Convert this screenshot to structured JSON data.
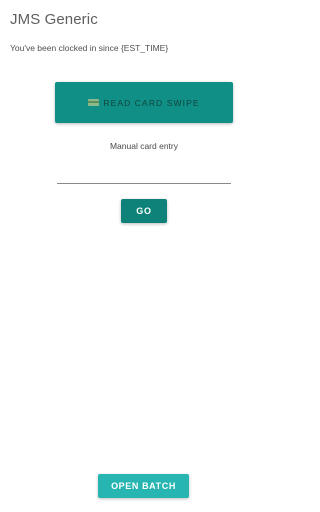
{
  "app": {
    "title": "JMS Generic"
  },
  "status": {
    "clock_message": "You've been clocked in since {EST_TIME}"
  },
  "card_swipe": {
    "button_label": "READ CARD SWIPE",
    "icon": "credit-card-icon",
    "accent_color": "#0f8f85"
  },
  "manual_entry": {
    "label": "Manual card entry",
    "value": "",
    "placeholder": ""
  },
  "go": {
    "label": "GO",
    "color": "#0e8278"
  },
  "batch": {
    "label": "OPEN BATCH",
    "color": "#26b5b0"
  }
}
